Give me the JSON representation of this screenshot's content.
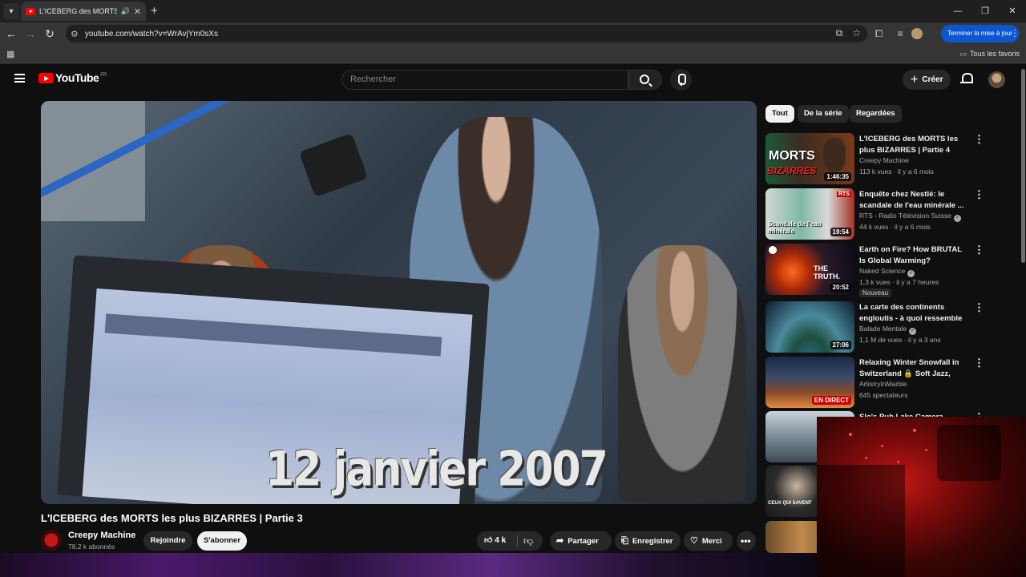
{
  "browser": {
    "tab_title": "L'ICEBERG des MORTS les p",
    "url": "youtube.com/watch?v=WrAvjYm0sXs",
    "update_button": "Terminer la mise à jour",
    "favorites_label": "Tous les favoris"
  },
  "youtube": {
    "logo_text": "YouTube",
    "region": "FR",
    "search_placeholder": "Rechercher",
    "create_label": "Créer"
  },
  "video": {
    "caption_in_frame": "12 janvier 2007",
    "title": "L'ICEBERG des MORTS les plus BIZARRES | Partie 3",
    "channel": "Creepy Machine",
    "subscribers": "78,2 k abonnés",
    "join_label": "Rejoindre",
    "subscribe_label": "S'abonner",
    "likes": "4 k",
    "share_label": "Partager",
    "save_label": "Enregistrer",
    "thanks_label": "Merci"
  },
  "chips": [
    "Tout",
    "De la série",
    "Regardées"
  ],
  "recommendations": [
    {
      "title": "L'ICEBERG des MORTS les plus BIZARRES | Partie 4",
      "channel": "Creepy Machine",
      "verified": false,
      "meta": "113 k vues · il y a 6 mois",
      "duration": "1:46:35",
      "badge": ""
    },
    {
      "title": "Enquête chez Nestlé: le scandale de l'eau minérale ...",
      "channel": "RTS - Radio Télévision Suisse",
      "verified": true,
      "meta": "44 k vues · il y a 6 mois",
      "duration": "19:54",
      "badge": ""
    },
    {
      "title": "Earth on Fire? How BRUTAL Is Global Warming?",
      "channel": "Naked Science",
      "verified": true,
      "meta": "1,3 k vues · il y a 7 heures",
      "duration": "20:52",
      "badge": "Nouveau"
    },
    {
      "title": "La carte des continents engloutis - à quoi ressemble la...",
      "channel": "Balade Mentale",
      "verified": true,
      "meta": "1,1 M de vues · il y a 3 ans",
      "duration": "27:06",
      "badge": ""
    },
    {
      "title": "Relaxing Winter Snowfall in Switzerland 🔒 Soft Jazz, Coz...",
      "channel": "ArtistryInMarble",
      "verified": false,
      "meta": "645 spectateurs",
      "duration": "EN DIRECT",
      "badge": ""
    },
    {
      "title": "Slo's Pub Lake Camera",
      "channel": "",
      "verified": false,
      "meta": "",
      "duration": "",
      "badge": ""
    }
  ],
  "thumb_texts": {
    "t1_big": "MORTS",
    "t1_sub": "BIZARRES",
    "t2_logo": "RTS",
    "t2_caption": "Scandale de l'eau minérale",
    "t3_caption": "THE TRUTH.",
    "t7_caption": "CEUX QUI SAVENT"
  },
  "colors": {
    "accent_red": "#ff0000",
    "background": "#0f0f0f",
    "update_blue": "#0b57d0"
  }
}
